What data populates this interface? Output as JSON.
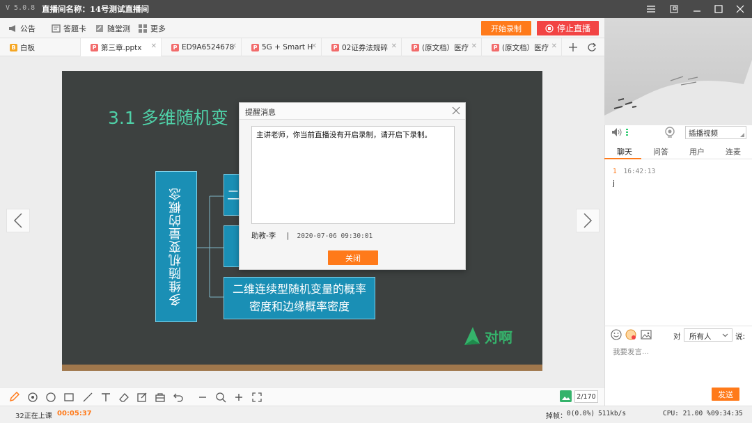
{
  "app": {
    "version": "V 5.0.8",
    "title": "直播间名称：14号测试直播间"
  },
  "toolbar": {
    "announce": "公告",
    "answer_card": "答题卡",
    "quiz": "随堂测",
    "more": "更多",
    "start_record": "开始录制",
    "stop_live": "停止直播"
  },
  "tabs": [
    {
      "label": "白板",
      "icon": "B",
      "color": "#f5a623"
    },
    {
      "label": "第三章.pptx",
      "icon": "P",
      "color": "#f26b6b"
    },
    {
      "label": "ED9A6524678",
      "icon": "P",
      "color": "#f26b6b"
    },
    {
      "label": "5G + Smart H",
      "icon": "P",
      "color": "#f26b6b"
    },
    {
      "label": "02证券法规碎",
      "icon": "P",
      "color": "#f26b6b"
    },
    {
      "label": "(原文档）医疗",
      "icon": "P",
      "color": "#f26b6b"
    },
    {
      "label": "(原文档）医疗",
      "icon": "P",
      "color": "#f26b6b"
    }
  ],
  "slide": {
    "title": "3.1  多维随机变",
    "vertical_box": "多维随机变量的概念",
    "box_item_1": "二",
    "box_last_line1": "二维连续型随机变量的概率",
    "box_last_line2": "密度和边缘概率密度",
    "brand": "对啊"
  },
  "dialog": {
    "title": "提醒消息",
    "message": "主讲老师，你当前直播没有开启录制，请开启下录制。",
    "sender": "助教-李",
    "separator": "|",
    "time": "2020-07-06 09:30:01",
    "close_label": "关闭"
  },
  "drawbar": {
    "page": "2/170"
  },
  "status": {
    "class_label": "32正在上课",
    "elapsed": "00:05:37",
    "lag_label": "掉帧：",
    "lag_value": "0(0.0%)",
    "bitrate": "511kb/s",
    "cpu": "CPU: 21.00 %",
    "clock": "09:34:35"
  },
  "right": {
    "video_select": "插播视频",
    "tabs": [
      "聊天",
      "问答",
      "用户",
      "连麦"
    ],
    "chat": [
      {
        "user": "1",
        "time": "16:42:13",
        "text": "j"
      }
    ],
    "to_label": "对",
    "recipient": "所有人",
    "say_label": "说:",
    "input_placeholder": "我要发言...",
    "send_label": "发送"
  },
  "colors": {
    "accent_orange": "#ff7a1a",
    "stop_red": "#f24444",
    "slide_bg": "#3d4140",
    "slide_box": "#1a8fb5",
    "slide_title": "#4fd1a8"
  }
}
